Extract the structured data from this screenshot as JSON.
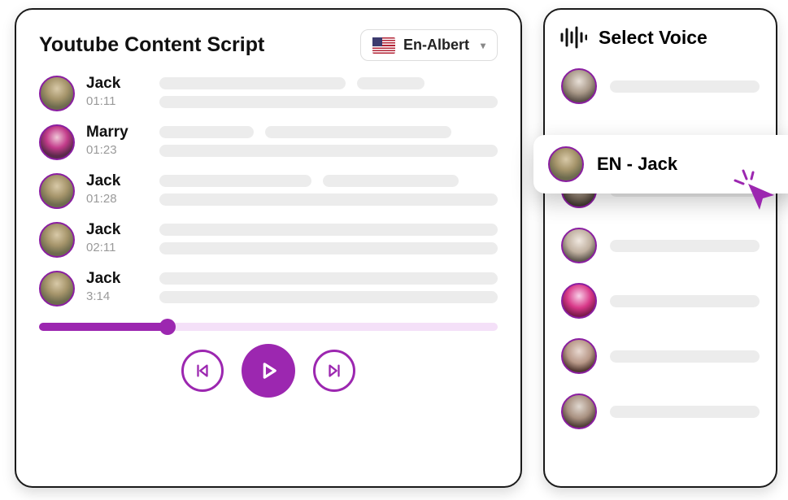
{
  "main": {
    "title": "Youtube Content Script",
    "language_selector": {
      "label": "En-Albert"
    },
    "rows": [
      {
        "speaker": "Jack",
        "time": "01:11"
      },
      {
        "speaker": "Marry",
        "time": "01:23"
      },
      {
        "speaker": "Jack",
        "time": "01:28"
      },
      {
        "speaker": "Jack",
        "time": "02:11"
      },
      {
        "speaker": "Jack",
        "time": "3:14"
      }
    ]
  },
  "sidebar": {
    "title": "Select Voice",
    "selected_label": "EN - Jack"
  }
}
